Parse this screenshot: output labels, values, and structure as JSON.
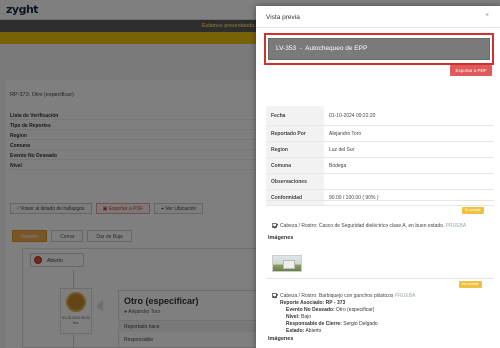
{
  "app": {
    "logo": "zyght",
    "banner_text": "Estamos presentando...",
    "report_title": "RP-373: Otro (especificar)",
    "info_rows": [
      "Lista de Verificación",
      "Tipo de Reportes",
      "Region",
      "Comuna",
      "Evento No Deseado",
      "Nivel"
    ],
    "actions": {
      "back": "Volver al listado de hallazgos",
      "export_pdf": "Exportar a PDF",
      "view_location": "Ver Ubicación"
    },
    "tabs": [
      "Gestión",
      "Cerrar",
      "Dar de Baja"
    ],
    "status": "Abierto",
    "timeline_date": "01-10-2024 09:22 Hrs.",
    "detail_title": "Otro (especificar)",
    "detail_user": "Alejandro Toro",
    "detail_rows": [
      "Reportado hace",
      "Responsable"
    ]
  },
  "modal": {
    "title": "Vista previa",
    "close": "×",
    "highlight_title": "LV-353  -  Autochequeo de EPP",
    "export_label": "Exportar a PDF",
    "rows": [
      {
        "label": "Fecha",
        "value": "01-10-2024 09:22:20"
      },
      {
        "label": "Reportado Por",
        "value": "Alejandro Toro"
      },
      {
        "label": "Region",
        "value": "Luz del Sur"
      },
      {
        "label": "Comuna",
        "value": "Bodega"
      },
      {
        "label": "Observaciones",
        "value": ""
      },
      {
        "label": "Conformidad",
        "value": "90.00 / 100.00 ( 90% )"
      }
    ],
    "item1": {
      "badge": "Sí cumple",
      "text": "Cabeza / Rostro: Casco de Seguridad dieléctrico clase A, en buen estado.",
      "tag": "PRUEBA"
    },
    "images_label": "Imágenes",
    "item2": {
      "badge": "No cumple",
      "text": "Cabeza / Rostro: Barbiquejo con ganchos plásticos",
      "tag": "PRUEBA",
      "reporte_label": "Reporte Asociado:",
      "reporte_value": "RP - 373",
      "evento_label": "Evento No Deseado:",
      "evento_value": "Otro (especificar)",
      "nivel_label": "Nivel:",
      "nivel_value": "Bajo",
      "resp_label": "Responsable de Cierre:",
      "resp_value": "Sergio Delgado",
      "estado_label": "Estado:",
      "estado_value": "Abierto"
    },
    "images_label_2": "Imágenes"
  },
  "colors": {
    "highlight_border": "#d32f2f",
    "export_button": "#e05a5a",
    "badge": "#f0c040",
    "accent_tab": "#f0ad4e"
  }
}
